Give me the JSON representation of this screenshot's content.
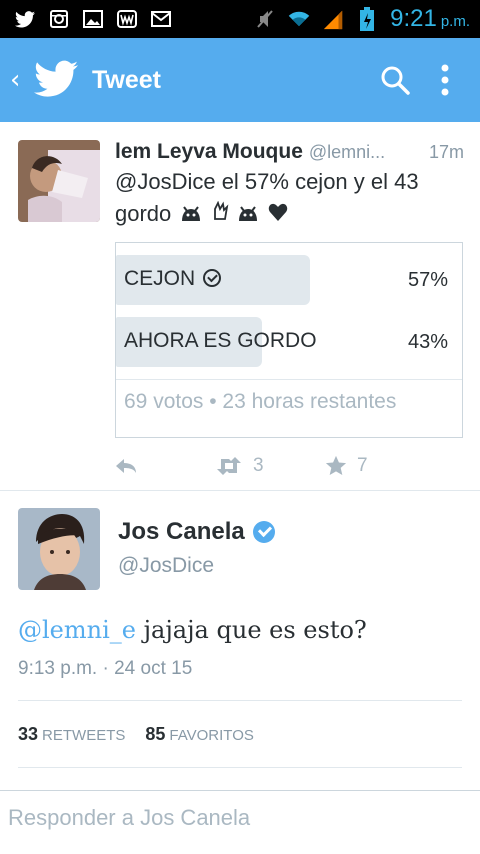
{
  "status": {
    "time": "9:21",
    "ampm": "p.m."
  },
  "header": {
    "title": "Tweet"
  },
  "tweet1": {
    "name": "lem Leyva Mouque",
    "handle": "@lemni...",
    "time": "17m",
    "text": "@JosDice el 57% cejon y el 43 gordo",
    "poll": {
      "options": [
        {
          "label": "CEJON",
          "percent": "57%",
          "value": 0.57,
          "winner": true
        },
        {
          "label": "AHORA ES GORDO",
          "percent": "43%",
          "value": 0.43,
          "winner": false
        }
      ],
      "footer": "69 votos • 23 horas restantes"
    },
    "retweets": "3",
    "likes": "7"
  },
  "tweet2": {
    "name": "Jos Canela",
    "handle": "@JosDice",
    "mention": "@lemni_e",
    "text": " jajaja que es esto?",
    "time": "9:13 p.m. · 24 oct 15",
    "retweets_count": "33",
    "retweets_label": "RETWEETS",
    "favorites_count": "85",
    "favorites_label": "FAVORITOS"
  },
  "reply": {
    "placeholder": "Responder a Jos Canela"
  },
  "colors": {
    "brand": "#55acee",
    "statusbar": "#000000",
    "clock": "#33b5e5"
  }
}
